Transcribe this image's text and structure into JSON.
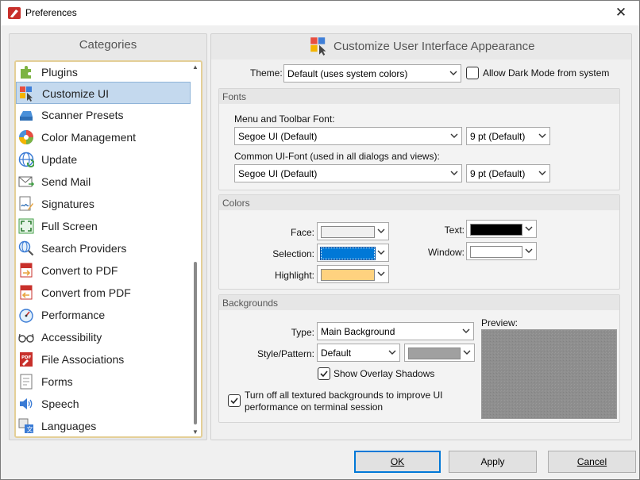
{
  "window": {
    "title": "Preferences"
  },
  "categories": {
    "header": "Categories",
    "items": [
      {
        "label": "Plugins",
        "icon": "puzzle-icon"
      },
      {
        "label": "Customize UI",
        "icon": "palette-cursor-icon"
      },
      {
        "label": "Scanner Presets",
        "icon": "scanner-icon"
      },
      {
        "label": "Color Management",
        "icon": "color-wheel-icon"
      },
      {
        "label": "Update",
        "icon": "globe-update-icon"
      },
      {
        "label": "Send Mail",
        "icon": "envelope-icon"
      },
      {
        "label": "Signatures",
        "icon": "signature-icon"
      },
      {
        "label": "Full Screen",
        "icon": "fullscreen-icon"
      },
      {
        "label": "Search Providers",
        "icon": "search-globe-icon"
      },
      {
        "label": "Convert to PDF",
        "icon": "convert-to-pdf-icon"
      },
      {
        "label": "Convert from PDF",
        "icon": "convert-from-pdf-icon"
      },
      {
        "label": "Performance",
        "icon": "gauge-icon"
      },
      {
        "label": "Accessibility",
        "icon": "glasses-icon"
      },
      {
        "label": "File Associations",
        "icon": "pdf-file-icon"
      },
      {
        "label": "Forms",
        "icon": "form-icon"
      },
      {
        "label": "Speech",
        "icon": "speaker-icon"
      },
      {
        "label": "Languages",
        "icon": "language-icon"
      }
    ],
    "selected": "Customize UI"
  },
  "main": {
    "header": "Customize User Interface Appearance",
    "theme": {
      "label": "Theme:",
      "value": "Default (uses system colors)",
      "dark_mode_label": "Allow Dark Mode from system",
      "dark_mode_checked": false
    },
    "fonts": {
      "title": "Fonts",
      "menu_font_label": "Menu and Toolbar Font:",
      "menu_font_value": "Segoe UI (Default)",
      "menu_font_size": "9 pt (Default)",
      "common_font_label": "Common UI-Font (used in all dialogs and views):",
      "common_font_value": "Segoe UI (Default)",
      "common_font_size": "9 pt (Default)"
    },
    "colors": {
      "title": "Colors",
      "face_label": "Face:",
      "selection_label": "Selection:",
      "highlight_label": "Highlight:",
      "text_label": "Text:",
      "window_label": "Window:",
      "face_color": "#f0f0f0",
      "selection_color": "#0078d7",
      "highlight_color": "#ffd27f",
      "text_color": "#000000",
      "window_color": "#ffffff"
    },
    "backgrounds": {
      "title": "Backgrounds",
      "type_label": "Type:",
      "type_value": "Main Background",
      "style_label": "Style/Pattern:",
      "style_value": "Default",
      "pattern_color": "#a0a0a0",
      "preview_label": "Preview:",
      "shadows_label": "Show Overlay Shadows",
      "shadows_checked": true,
      "textured_label_line1": "Turn off all textured backgrounds to improve UI",
      "textured_label_line2": "performance on terminal session",
      "textured_checked": true
    }
  },
  "buttons": {
    "ok": "OK",
    "apply": "Apply",
    "cancel": "Cancel"
  },
  "colors": {
    "accent": "#0078d7",
    "selected_bg": "#c4d9ee",
    "list_border": "#e4cf97"
  }
}
